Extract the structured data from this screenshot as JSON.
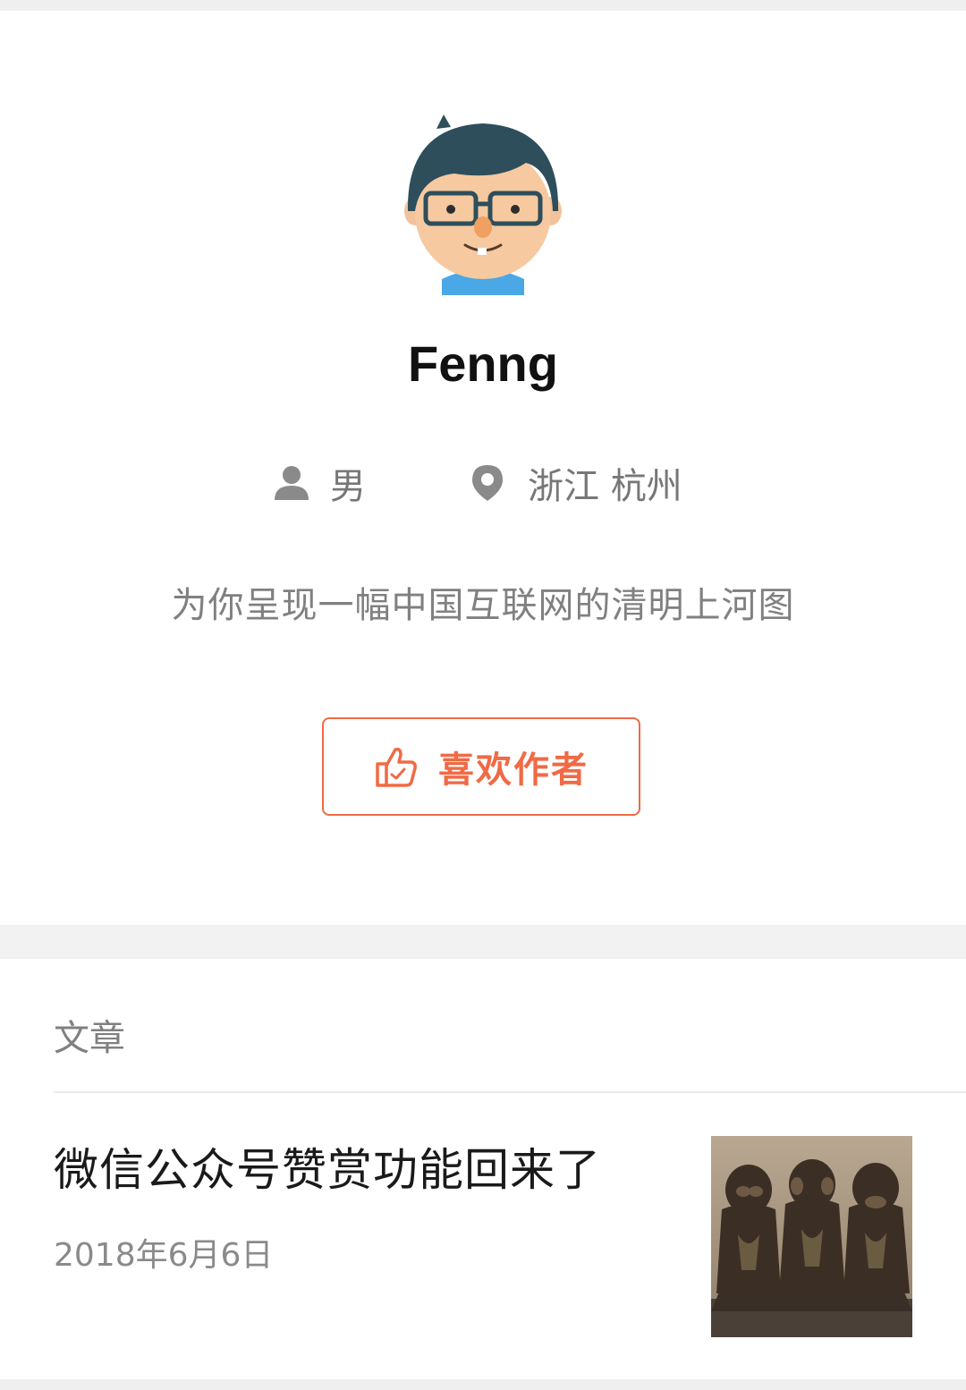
{
  "profile": {
    "name": "Fenng",
    "gender": "男",
    "location": "浙江 杭州",
    "bio": "为你呈现一幅中国互联网的清明上河图",
    "like_button_label": "喜欢作者"
  },
  "articles": {
    "section_title": "文章",
    "items": [
      {
        "title": "微信公众号赞赏功能回来了",
        "date": "2018年6月6日"
      }
    ]
  },
  "colors": {
    "accent": "#f06a45",
    "text_primary": "#111111",
    "text_secondary": "#808080",
    "background": "#f2f2f2"
  },
  "icons": {
    "gender": "person-icon",
    "location": "location-pin-icon",
    "like": "thumbs-up-icon"
  }
}
